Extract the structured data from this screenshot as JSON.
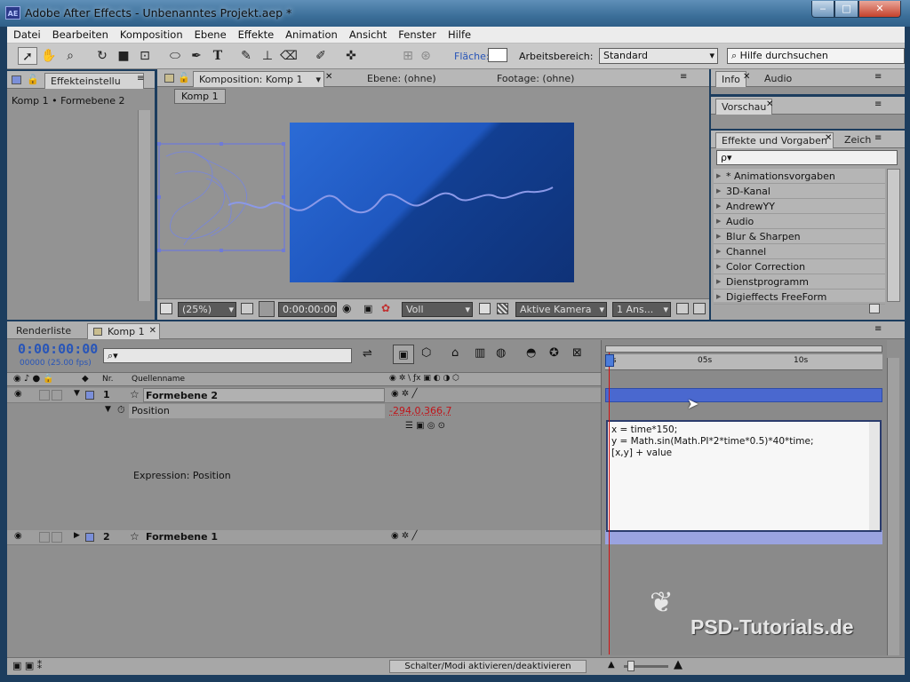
{
  "app": {
    "title": "Adobe After Effects - Unbenanntes Projekt.aep *",
    "icon_text": "AE"
  },
  "menu": [
    "Datei",
    "Bearbeiten",
    "Komposition",
    "Ebene",
    "Effekte",
    "Animation",
    "Ansicht",
    "Fenster",
    "Hilfe"
  ],
  "toolbar": {
    "flaeche_label": "Fläche:",
    "workspace_label": "Arbeitsbereich:",
    "workspace_value": "Standard",
    "help_placeholder": "Hilfe durchsuchen"
  },
  "effect_controls": {
    "tab": "Effekteinstellu",
    "breadcrumb": "Komp 1 • Formebene 2"
  },
  "viewer": {
    "tabs": [
      "Komposition: Komp 1",
      "Ebene: (ohne)",
      "Footage: (ohne)"
    ],
    "comp_button": "Komp 1",
    "zoom": "(25%)",
    "timecode": "0:00:00:00",
    "resolution": "Voll",
    "camera": "Aktive Kamera",
    "views": "1 Ans..."
  },
  "right_panels": {
    "info_tab": "Info",
    "audio_tab": "Audio",
    "preview_tab": "Vorschau",
    "effects_tab": "Effekte und Vorgaben",
    "char_tab": "Zeich",
    "search_prefix": "ρ▾",
    "items": [
      "* Animationsvorgaben",
      "3D-Kanal",
      "AndrewYY",
      "Audio",
      "Blur & Sharpen",
      "Channel",
      "Color Correction",
      "Dienstprogramm",
      "Digieffects FreeForm"
    ]
  },
  "timeline": {
    "tabs": [
      "Renderliste",
      "Komp 1"
    ],
    "timecode": "0:00:00:00",
    "frame_info": "00000 (25.00 fps)",
    "col_nr": "Nr.",
    "col_source": "Quellenname",
    "layers": [
      {
        "nr": "1",
        "name": "Formebene 2"
      },
      {
        "nr": "2",
        "name": "Formebene 1"
      }
    ],
    "property": "Position",
    "property_value": "-294,0,366,7",
    "expression_label": "Expression: Position",
    "expression_lines": [
      "x = time*150;",
      "y = Math.sin(Math.PI*2*time*0.5)*40*time;",
      "[x,y]  + value"
    ],
    "ruler": [
      "0s",
      "05s",
      "10s"
    ],
    "footer_button": "Schalter/Modi aktivieren/deaktivieren"
  },
  "watermark": "PSD-Tutorials.de",
  "colors": {
    "title_bar": "#3c6f99",
    "panel": "#939393",
    "comp_blue": "#1f4fa3",
    "timecode_blue": "#2855b8",
    "red_value": "#c0141a",
    "layer_bar": "#4a68cf"
  }
}
